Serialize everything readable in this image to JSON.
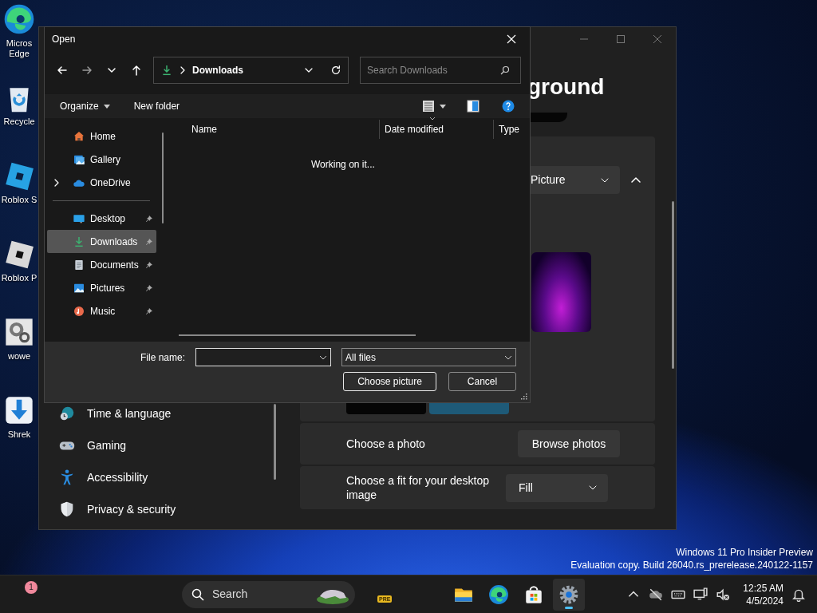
{
  "desktop_icons": [
    {
      "kind": "edge",
      "label": "Micros Edge"
    },
    {
      "kind": "recycle",
      "label": "Recycle"
    },
    {
      "kind": "roblox-studio",
      "label": "Roblox S"
    },
    {
      "kind": "roblox-player",
      "label": "Roblox P"
    },
    {
      "kind": "gear-shortcut",
      "label": "wowe"
    },
    {
      "kind": "download",
      "label": "Shrek"
    }
  ],
  "settings_window": {
    "heading": "ground",
    "nav_items": [
      {
        "kind": "clock",
        "label": "Time & language"
      },
      {
        "kind": "gamepad",
        "label": "Gaming"
      },
      {
        "kind": "accessibility",
        "label": "Accessibility"
      },
      {
        "kind": "shield",
        "label": "Privacy & security"
      }
    ],
    "background_type": {
      "value": "Picture",
      "expanded": true
    },
    "photo_row": {
      "label": "Choose a photo",
      "button": "Browse photos"
    },
    "fit_row": {
      "label": "Choose a fit for your desktop image",
      "value": "Fill"
    }
  },
  "open_dialog": {
    "title": "Open",
    "address": {
      "location": "Downloads"
    },
    "search": {
      "placeholder": "Search Downloads"
    },
    "commands": [
      {
        "label": "Organize",
        "dropdown": true
      },
      {
        "label": "New folder",
        "dropdown": false
      }
    ],
    "nav_pane": [
      {
        "kind": "home",
        "label": "Home",
        "selected": false,
        "pinned": false,
        "expandable": false
      },
      {
        "kind": "gallery",
        "label": "Gallery",
        "selected": false,
        "pinned": false,
        "expandable": false
      },
      {
        "kind": "onedrive",
        "label": "OneDrive",
        "selected": false,
        "pinned": false,
        "expandable": true
      },
      {
        "kind": "divider"
      },
      {
        "kind": "desktop",
        "label": "Desktop",
        "selected": false,
        "pinned": true,
        "expandable": false
      },
      {
        "kind": "downloads",
        "label": "Downloads",
        "selected": true,
        "pinned": true,
        "expandable": false
      },
      {
        "kind": "documents",
        "label": "Documents",
        "selected": false,
        "pinned": true,
        "expandable": false
      },
      {
        "kind": "pictures",
        "label": "Pictures",
        "selected": false,
        "pinned": true,
        "expandable": false
      },
      {
        "kind": "music",
        "label": "Music",
        "selected": false,
        "pinned": true,
        "expandable": false
      }
    ],
    "columns": [
      {
        "label": "Name",
        "sorted": false
      },
      {
        "label": "Date modified",
        "sorted": true
      },
      {
        "label": "Type",
        "sorted": false
      }
    ],
    "status": "Working on it...",
    "file_name": {
      "label": "File name:"
    },
    "filter": {
      "value": "All files"
    },
    "buttons": [
      {
        "label": "Choose picture",
        "default": true
      },
      {
        "label": "Cancel",
        "default": false
      }
    ]
  },
  "evaluation_notice": [
    "Windows 11 Pro Insider Preview",
    "Evaluation copy. Build 26040.rs_prerelease.240122-1157"
  ],
  "taskbar": {
    "widgets_badge": "1",
    "search": {
      "placeholder": "Search"
    },
    "preview_badge": "PRE",
    "apps": [
      {
        "kind": "explorer",
        "active": false
      },
      {
        "kind": "edge",
        "active": false
      },
      {
        "kind": "store",
        "active": false
      },
      {
        "kind": "settings",
        "active": true
      }
    ],
    "clock": {
      "time": "12:25 AM",
      "date": "4/5/2024"
    }
  }
}
